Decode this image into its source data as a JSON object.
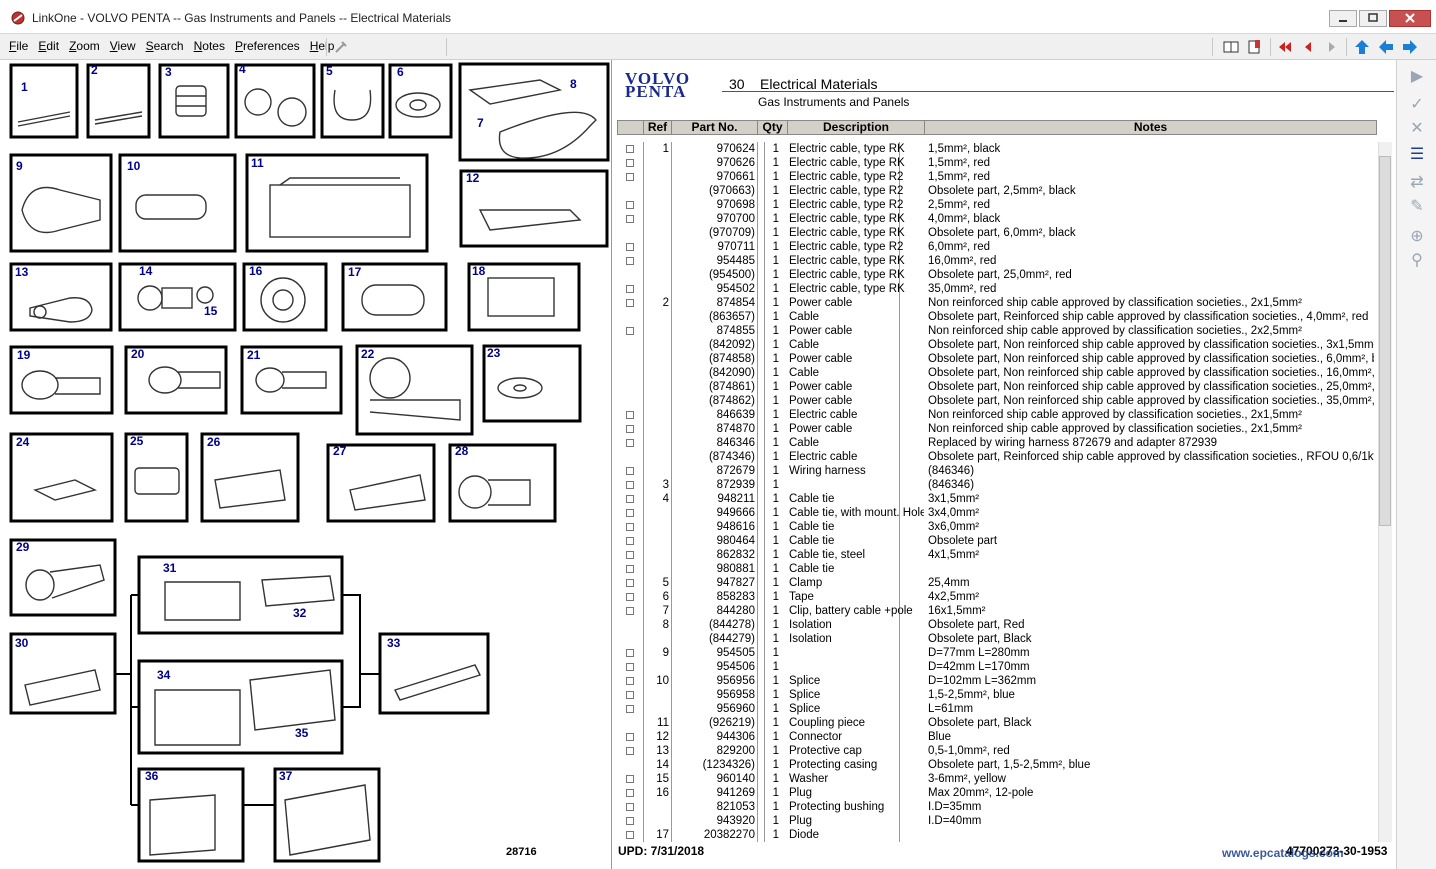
{
  "window": {
    "title": "LinkOne - VOLVO PENTA -- Gas Instruments and Panels -- Electrical Materials"
  },
  "menu": [
    "File",
    "Edit",
    "Zoom",
    "View",
    "Search",
    "Notes",
    "Preferences",
    "Help"
  ],
  "header": {
    "logo_line1": "VOLVO",
    "logo_line2": "PENTA",
    "section_number": "30",
    "section_title": "Electrical Materials",
    "subtitle": "Gas Instruments and Panels"
  },
  "columns": [
    "Ref",
    "Part No.",
    "Qty",
    "Description",
    "Notes"
  ],
  "rows": [
    {
      "chk": true,
      "ref": "1",
      "part": "970624",
      "qty": "1",
      "desc": "Electric cable, type RK",
      "notes": "1,5mm², black"
    },
    {
      "chk": true,
      "ref": "",
      "part": "970626",
      "qty": "1",
      "desc": "Electric cable, type RK",
      "notes": "1,5mm², red"
    },
    {
      "chk": true,
      "ref": "",
      "part": "970661",
      "qty": "1",
      "desc": "Electric cable, type R2",
      "notes": "1,5mm², red"
    },
    {
      "chk": false,
      "ref": "",
      "part": "(970663)",
      "qty": "1",
      "desc": "Electric cable, type R2",
      "notes": "Obsolete part, 2,5mm², black"
    },
    {
      "chk": true,
      "ref": "",
      "part": "970698",
      "qty": "1",
      "desc": "Electric cable, type R2",
      "notes": "2,5mm², red"
    },
    {
      "chk": true,
      "ref": "",
      "part": "970700",
      "qty": "1",
      "desc": "Electric cable, type RK",
      "notes": "4,0mm², black"
    },
    {
      "chk": false,
      "ref": "",
      "part": "(970709)",
      "qty": "1",
      "desc": "Electric cable, type RK",
      "notes": "Obsolete part, 6,0mm², black"
    },
    {
      "chk": true,
      "ref": "",
      "part": "970711",
      "qty": "1",
      "desc": "Electric cable, type R2",
      "notes": "6,0mm², red"
    },
    {
      "chk": true,
      "ref": "",
      "part": "954485",
      "qty": "1",
      "desc": "Electric cable, type RK",
      "notes": "16,0mm², red"
    },
    {
      "chk": false,
      "ref": "",
      "part": "(954500)",
      "qty": "1",
      "desc": "Electric cable, type RK",
      "notes": "Obsolete part, 25,0mm², red"
    },
    {
      "chk": true,
      "ref": "",
      "part": "954502",
      "qty": "1",
      "desc": "Electric cable, type RK",
      "notes": "35,0mm², red"
    },
    {
      "chk": true,
      "ref": "2",
      "part": "874854",
      "qty": "1",
      "desc": "Power cable",
      "notes": "Non reinforced ship cable approved by classification societies., 2x1,5mm²"
    },
    {
      "chk": false,
      "ref": "",
      "part": "(863657)",
      "qty": "1",
      "desc": "Cable",
      "notes": "Obsolete part, Reinforced ship cable approved by classification societies., 4,0mm², red"
    },
    {
      "chk": true,
      "ref": "",
      "part": "874855",
      "qty": "1",
      "desc": "Power cable",
      "notes": "Non reinforced ship cable approved by classification societies., 2x2,5mm²"
    },
    {
      "chk": false,
      "ref": "",
      "part": "(842092)",
      "qty": "1",
      "desc": "Cable",
      "notes": "Obsolete part, Non reinforced ship cable approved by classification societies., 3x1,5mm²"
    },
    {
      "chk": false,
      "ref": "",
      "part": "(874858)",
      "qty": "1",
      "desc": "Power cable",
      "notes": "Obsolete part, Non reinforced ship cable approved by classification societies., 6,0mm², black"
    },
    {
      "chk": false,
      "ref": "",
      "part": "(842090)",
      "qty": "1",
      "desc": "Cable",
      "notes": "Obsolete part, Non reinforced ship cable approved by classification societies., 16,0mm², red"
    },
    {
      "chk": false,
      "ref": "",
      "part": "(874861)",
      "qty": "1",
      "desc": "Power cable",
      "notes": "Obsolete part, Non reinforced ship cable approved by classification societies., 25,0mm², red"
    },
    {
      "chk": false,
      "ref": "",
      "part": "(874862)",
      "qty": "1",
      "desc": "Power cable",
      "notes": "Obsolete part, Non reinforced ship cable approved by classification societies., 35,0mm², red"
    },
    {
      "chk": true,
      "ref": "",
      "part": "846639",
      "qty": "1",
      "desc": "Electric cable",
      "notes": "Non reinforced ship cable approved by classification societies., 2x1,5mm²"
    },
    {
      "chk": true,
      "ref": "",
      "part": "874870",
      "qty": "1",
      "desc": "Power cable",
      "notes": "Non reinforced ship cable approved by classification societies., 2x1,5mm²"
    },
    {
      "chk": true,
      "ref": "",
      "part": "846346",
      "qty": "1",
      "desc": "Cable",
      "notes": "Replaced by wiring harness 872679 and adapter 872939"
    },
    {
      "chk": false,
      "ref": "",
      "part": "(874346)",
      "qty": "1",
      "desc": "Electric cable",
      "notes": "Obsolete part, Reinforced ship cable approved by classification societies., RFOU 0,6/1kv"
    },
    {
      "chk": true,
      "ref": "",
      "part": "872679",
      "qty": "1",
      "desc": "Wiring harness",
      "notes": "(846346)"
    },
    {
      "chk": true,
      "ref": "3",
      "part": "872939",
      "qty": "1",
      "desc": "",
      "notes": "(846346)"
    },
    {
      "chk": true,
      "ref": "4",
      "part": "948211",
      "qty": "1",
      "desc": "Cable tie",
      "notes": "3x1,5mm²"
    },
    {
      "chk": true,
      "ref": "",
      "part": "949666",
      "qty": "1",
      "desc": "Cable tie, with mount. Hole",
      "notes": "3x4,0mm²"
    },
    {
      "chk": true,
      "ref": "",
      "part": "948616",
      "qty": "1",
      "desc": "Cable tie",
      "notes": "3x6,0mm²"
    },
    {
      "chk": true,
      "ref": "",
      "part": "980464",
      "qty": "1",
      "desc": "Cable tie",
      "notes": "Obsolete part"
    },
    {
      "chk": true,
      "ref": "",
      "part": "862832",
      "qty": "1",
      "desc": "Cable tie, steel",
      "notes": "4x1,5mm²"
    },
    {
      "chk": true,
      "ref": "",
      "part": "980881",
      "qty": "1",
      "desc": "Cable tie",
      "notes": ""
    },
    {
      "chk": true,
      "ref": "5",
      "part": "947827",
      "qty": "1",
      "desc": "Clamp",
      "notes": "25,4mm"
    },
    {
      "chk": true,
      "ref": "6",
      "part": "858283",
      "qty": "1",
      "desc": "Tape",
      "notes": "4x2,5mm²"
    },
    {
      "chk": true,
      "ref": "7",
      "part": "844280",
      "qty": "1",
      "desc": "Clip, battery cable +pole",
      "notes": "16x1,5mm²"
    },
    {
      "chk": false,
      "ref": "8",
      "part": "(844278)",
      "qty": "1",
      "desc": "Isolation",
      "notes": "Obsolete part, Red"
    },
    {
      "chk": false,
      "ref": "",
      "part": "(844279)",
      "qty": "1",
      "desc": "Isolation",
      "notes": "Obsolete part, Black"
    },
    {
      "chk": true,
      "ref": "9",
      "part": "954505",
      "qty": "1",
      "desc": "",
      "notes": "D=77mm L=280mm"
    },
    {
      "chk": true,
      "ref": "",
      "part": "954506",
      "qty": "1",
      "desc": "",
      "notes": "D=42mm L=170mm"
    },
    {
      "chk": true,
      "ref": "10",
      "part": "956956",
      "qty": "1",
      "desc": "Splice",
      "notes": "D=102mm L=362mm"
    },
    {
      "chk": true,
      "ref": "",
      "part": "956958",
      "qty": "1",
      "desc": "Splice",
      "notes": "1,5-2,5mm², blue"
    },
    {
      "chk": true,
      "ref": "",
      "part": "956960",
      "qty": "1",
      "desc": "Splice",
      "notes": "L=61mm"
    },
    {
      "chk": false,
      "ref": "11",
      "part": "(926219)",
      "qty": "1",
      "desc": "Coupling piece",
      "notes": "Obsolete part, Black"
    },
    {
      "chk": true,
      "ref": "12",
      "part": "944306",
      "qty": "1",
      "desc": "Connector",
      "notes": "Blue"
    },
    {
      "chk": true,
      "ref": "13",
      "part": "829200",
      "qty": "1",
      "desc": "Protective cap",
      "notes": "0,5-1,0mm², red"
    },
    {
      "chk": false,
      "ref": "14",
      "part": "(1234326)",
      "qty": "1",
      "desc": "Protecting casing",
      "notes": "Obsolete part, 1,5-2,5mm², blue"
    },
    {
      "chk": true,
      "ref": "15",
      "part": "960140",
      "qty": "1",
      "desc": "Washer",
      "notes": "3-6mm², yellow"
    },
    {
      "chk": true,
      "ref": "16",
      "part": "941269",
      "qty": "1",
      "desc": "Plug",
      "notes": "Max 20mm², 12-pole"
    },
    {
      "chk": true,
      "ref": "",
      "part": "821053",
      "qty": "1",
      "desc": "Protecting bushing",
      "notes": "I.D=35mm"
    },
    {
      "chk": true,
      "ref": "",
      "part": "943920",
      "qty": "1",
      "desc": "Plug",
      "notes": "I.D=40mm"
    },
    {
      "chk": true,
      "ref": "17",
      "part": "20382270",
      "qty": "1",
      "desc": "Diode",
      "notes": ""
    }
  ],
  "illustration_numbers": [
    "1",
    "2",
    "3",
    "4",
    "5",
    "6",
    "7",
    "8",
    "9",
    "10",
    "11",
    "12",
    "13",
    "14",
    "15",
    "16",
    "17",
    "18",
    "19",
    "20",
    "21",
    "22",
    "23",
    "24",
    "25",
    "26",
    "27",
    "28",
    "29",
    "30",
    "31",
    "32",
    "33",
    "34",
    "35",
    "36",
    "37"
  ],
  "illustration_code": "28716",
  "footer": {
    "updated": "UPD: 7/31/2018",
    "doc_code": "47700273-30-1953",
    "watermark": "www.epcatalogs.com"
  }
}
